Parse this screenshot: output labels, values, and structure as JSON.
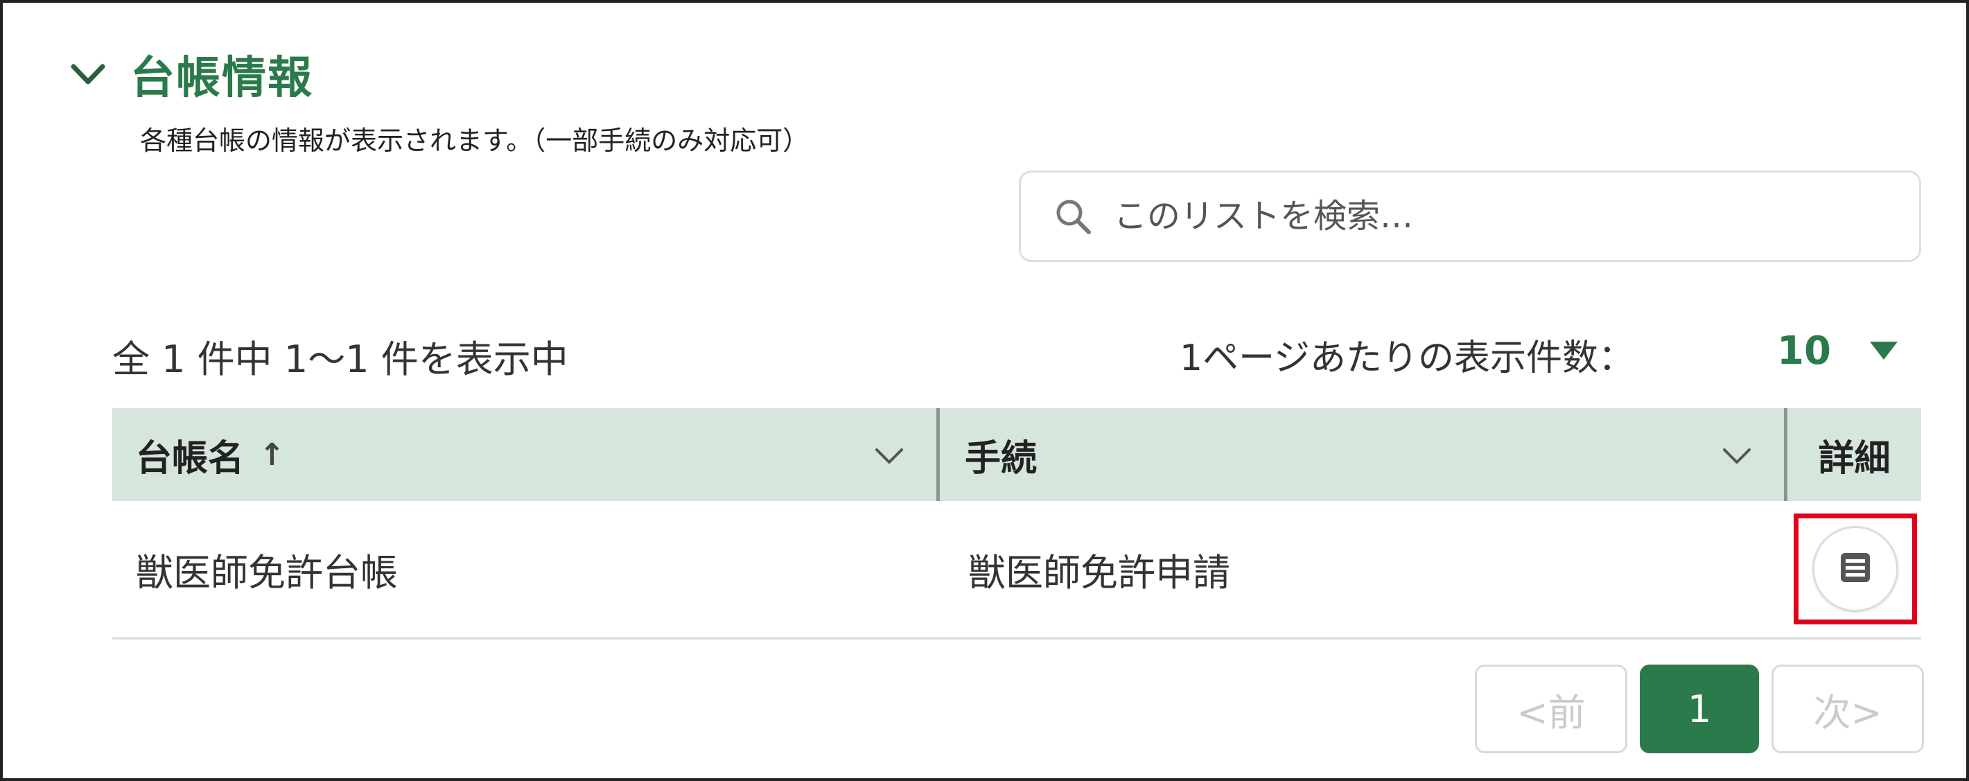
{
  "section": {
    "title": "台帳情報",
    "description": "各種台帳の情報が表示されます。（一部手続のみ対応可）",
    "chevron_icon": "chevron-down-icon"
  },
  "search": {
    "placeholder": "このリストを検索…",
    "icon": "search-icon"
  },
  "summary": {
    "count_text": "全 1 件中 1〜1 件を表示中",
    "per_page_label": "1ページあたりの表示件数：",
    "per_page_value": "10"
  },
  "table": {
    "headers": {
      "name": "台帳名",
      "name_sort": "↑",
      "procedure": "手続",
      "detail": "詳細"
    },
    "rows": [
      {
        "name": "獣医師免許台帳",
        "procedure": "獣医師免許申請",
        "detail_icon": "document-list-icon"
      }
    ]
  },
  "pagination": {
    "prev": "<前",
    "current": "1",
    "next": "次>"
  },
  "colors": {
    "accent": "#2b7a4b",
    "header_bg": "#d6e6dd",
    "highlight": "#e0001b"
  }
}
